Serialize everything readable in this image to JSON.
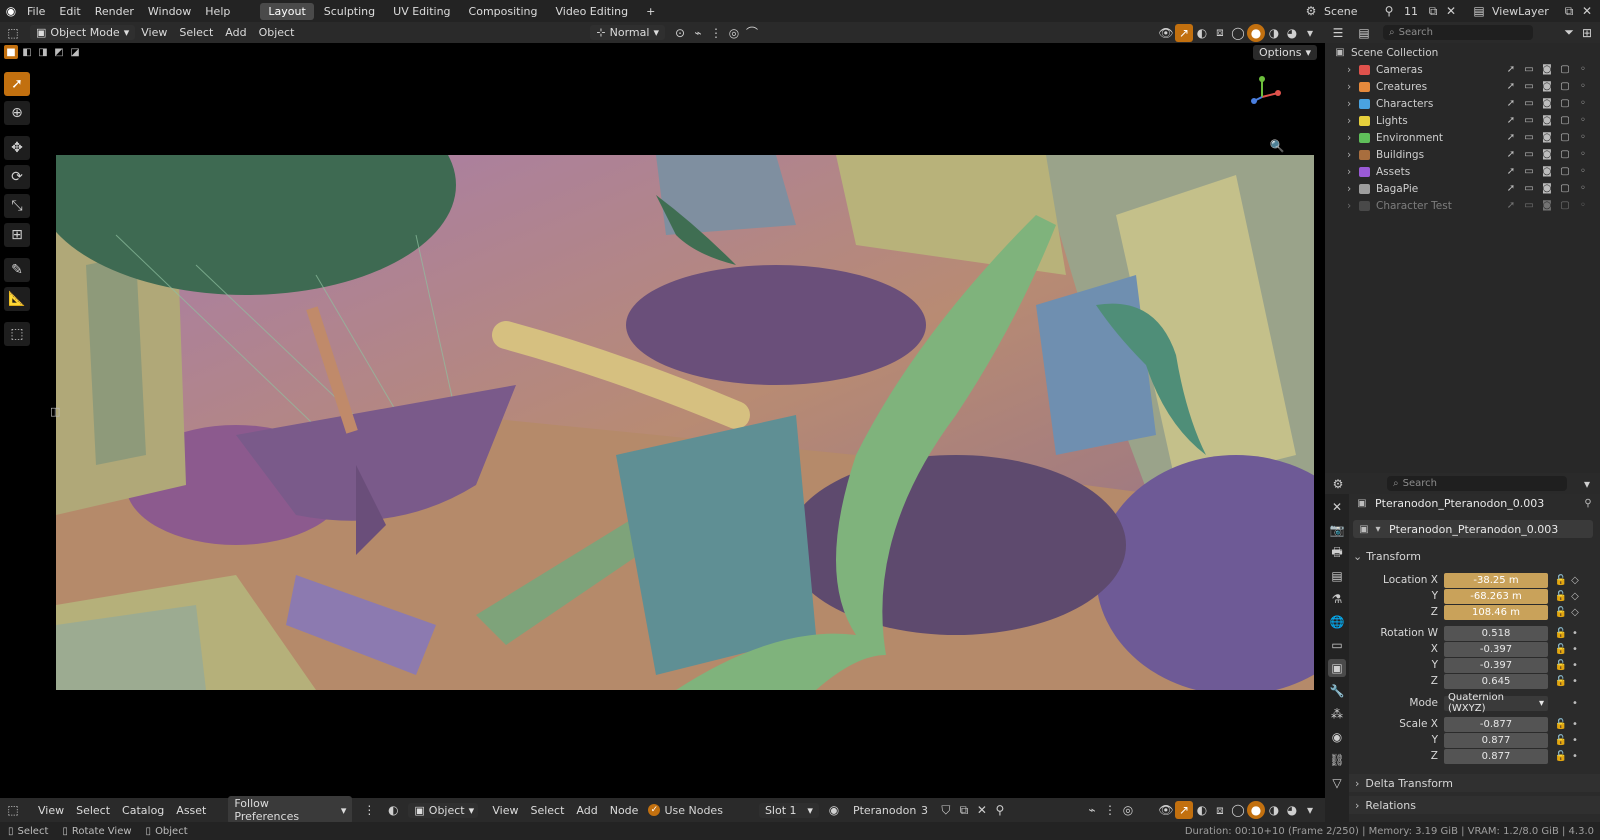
{
  "topbar": {
    "menus": [
      "File",
      "Edit",
      "Render",
      "Window",
      "Help"
    ],
    "workspaces": [
      "Layout",
      "Sculpting",
      "UV Editing",
      "Compositing",
      "Video Editing"
    ],
    "active_workspace": "Layout",
    "add_tab": "+",
    "scene_label": "Scene",
    "scene_count": "11",
    "viewlayer_label": "ViewLayer"
  },
  "viewport_header": {
    "mode": "Object Mode",
    "menus": [
      "View",
      "Select",
      "Add",
      "Object"
    ],
    "orientation": "Normal",
    "options": "Options"
  },
  "outliner": {
    "search_placeholder": "Search",
    "root": "Scene Collection",
    "collections": [
      {
        "name": "Cameras",
        "color": "#e0524c"
      },
      {
        "name": "Creatures",
        "color": "#e68a3c"
      },
      {
        "name": "Characters",
        "color": "#4aa3e0"
      },
      {
        "name": "Lights",
        "color": "#e6cf3c"
      },
      {
        "name": "Environment",
        "color": "#5fbf5a"
      },
      {
        "name": "Buildings",
        "color": "#a86e3e"
      },
      {
        "name": "Assets",
        "color": "#9a5ad6"
      },
      {
        "name": "BagaPie",
        "color": "#9e9e9e"
      },
      {
        "name": "Character Test",
        "color": "#6a6a6a"
      }
    ]
  },
  "properties": {
    "search_placeholder": "Search",
    "object_name": "Pteranodon_Pteranodon_0.003",
    "object_field": "Pteranodon_Pteranodon_0.003",
    "panel_transform": "Transform",
    "location": {
      "label": "Location X",
      "x": "-38.25 m",
      "y": "-68.263 m",
      "z": "108.46 m"
    },
    "rotation": {
      "label": "Rotation W",
      "w": "0.518",
      "x": "-0.397",
      "y": "-0.397",
      "z": "0.645"
    },
    "mode_label": "Mode",
    "mode_value": "Quaternion (WXYZ)",
    "scale": {
      "label": "Scale X",
      "x": "-0.877",
      "y": "0.877",
      "z": "0.877"
    },
    "axis_y": "Y",
    "axis_z": "Z",
    "axis_x": "X",
    "delta_transform": "Delta Transform",
    "relations": "Relations"
  },
  "node_header": {
    "menus": [
      "View",
      "Select",
      "Catalog",
      "Asset"
    ],
    "follow": "Follow Preferences",
    "object": "Object",
    "menus2": [
      "View",
      "Select",
      "Add",
      "Node"
    ],
    "use_nodes": "Use Nodes",
    "slot": "Slot 1",
    "material": "Pteranodon",
    "users": "3"
  },
  "statusbar": {
    "select": "Select",
    "rotate": "Rotate View",
    "object": "Object",
    "info": "Duration: 00:10+10 (Frame 2/250) | Memory: 3.19 GiB | VRAM: 1.2/8.0 GiB | 4.3.0"
  },
  "colors": {
    "accent": "#c2700f",
    "animated_field": "#c9a25a"
  }
}
